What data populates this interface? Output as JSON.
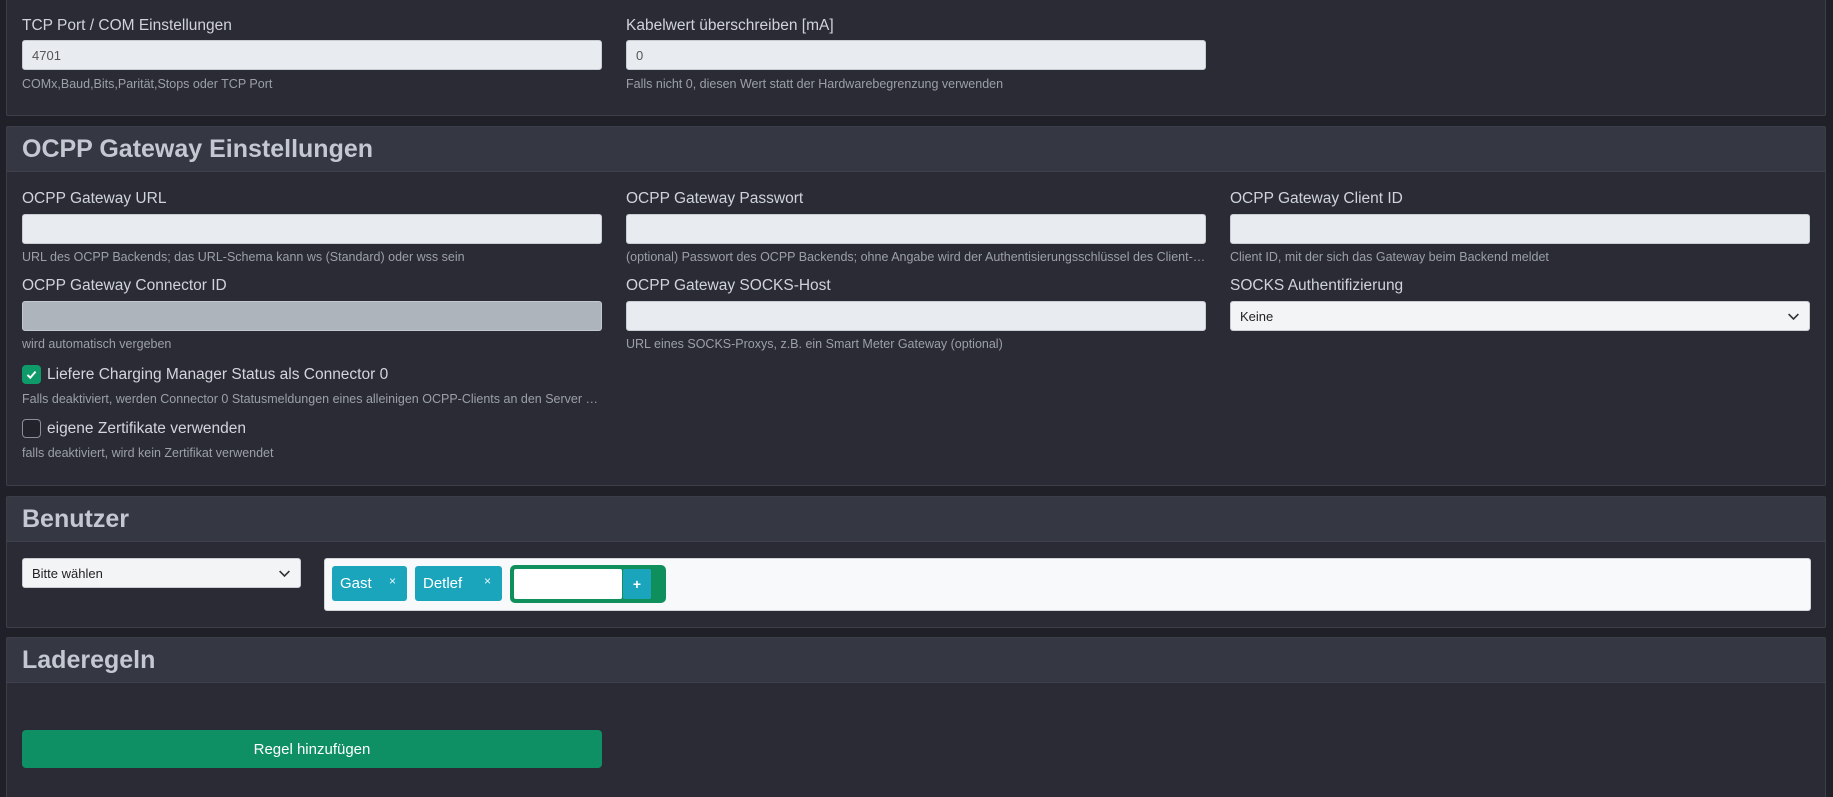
{
  "top_card": {
    "tcp_label": "TCP Port / COM Einstellungen",
    "tcp_value": "4701",
    "tcp_help": "COMx,Baud,Bits,Parität,Stops oder TCP Port",
    "cable_label": "Kabelwert überschreiben [mA]",
    "cable_value": "0",
    "cable_help": "Falls nicht 0, diesen Wert statt der Hardwarebegrenzung verwenden"
  },
  "ocpp": {
    "title": "OCPP Gateway Einstellungen",
    "url_label": "OCPP Gateway URL",
    "url_value": "",
    "url_help": "URL des OCPP Backends; das URL-Schema kann ws (Standard) oder wss sein",
    "password_label": "OCPP Gateway Passwort",
    "password_value": "",
    "password_help": "(optional) Passwort des OCPP Backends; ohne Angabe wird der Authentisierungsschlüssel des Client-Zertifikats verwendet",
    "client_id_label": "OCPP Gateway Client ID",
    "client_id_value": "",
    "client_id_help": "Client ID, mit der sich das Gateway beim Backend meldet",
    "connector_label": "OCPP Gateway Connector ID",
    "connector_value": "",
    "connector_help": "wird automatisch vergeben",
    "socks_host_label": "OCPP Gateway SOCKS-Host",
    "socks_host_value": "",
    "socks_host_help": "URL eines SOCKS-Proxys, z.B. ein Smart Meter Gateway (optional)",
    "socks_auth_label": "SOCKS Authentifizierung",
    "socks_auth_value": "Keine",
    "cm_status_label": "Liefere Charging Manager Status als Connector 0",
    "cm_status_checked": true,
    "cm_status_help": "Falls deaktiviert, werden Connector 0 Statusmeldungen eines alleinigen OCPP-Clients an den Server weitergeleitet",
    "certs_label": "eigene Zertifikate verwenden",
    "certs_checked": false,
    "certs_help": "falls deaktiviert, wird kein Zertifikat verwendet"
  },
  "users": {
    "title": "Benutzer",
    "select_value": "Bitte wählen",
    "tags": [
      "Gast",
      "Detlef"
    ],
    "tag_remove_symbol": "×",
    "tag_input_value": "",
    "add_symbol": "+"
  },
  "rules": {
    "title": "Laderegeln",
    "add_button_label": "Regel hinzufügen"
  },
  "colors": {
    "accent_green": "#0f9064",
    "tag_blue": "#1aa5bd",
    "card_bg": "#2a2b34",
    "header_bg": "#353843"
  }
}
